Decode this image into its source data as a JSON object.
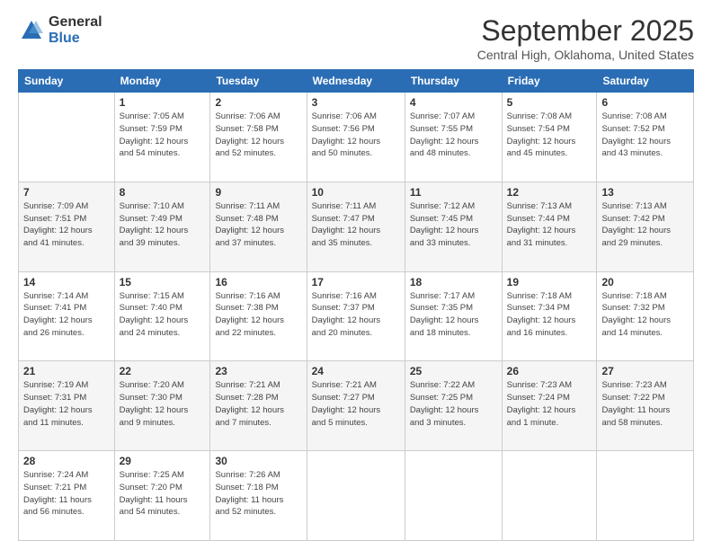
{
  "header": {
    "logo_general": "General",
    "logo_blue": "Blue",
    "month_title": "September 2025",
    "location": "Central High, Oklahoma, United States"
  },
  "days_of_week": [
    "Sunday",
    "Monday",
    "Tuesday",
    "Wednesday",
    "Thursday",
    "Friday",
    "Saturday"
  ],
  "weeks": [
    [
      {
        "day": "",
        "info": ""
      },
      {
        "day": "1",
        "info": "Sunrise: 7:05 AM\nSunset: 7:59 PM\nDaylight: 12 hours\nand 54 minutes."
      },
      {
        "day": "2",
        "info": "Sunrise: 7:06 AM\nSunset: 7:58 PM\nDaylight: 12 hours\nand 52 minutes."
      },
      {
        "day": "3",
        "info": "Sunrise: 7:06 AM\nSunset: 7:56 PM\nDaylight: 12 hours\nand 50 minutes."
      },
      {
        "day": "4",
        "info": "Sunrise: 7:07 AM\nSunset: 7:55 PM\nDaylight: 12 hours\nand 48 minutes."
      },
      {
        "day": "5",
        "info": "Sunrise: 7:08 AM\nSunset: 7:54 PM\nDaylight: 12 hours\nand 45 minutes."
      },
      {
        "day": "6",
        "info": "Sunrise: 7:08 AM\nSunset: 7:52 PM\nDaylight: 12 hours\nand 43 minutes."
      }
    ],
    [
      {
        "day": "7",
        "info": "Sunrise: 7:09 AM\nSunset: 7:51 PM\nDaylight: 12 hours\nand 41 minutes."
      },
      {
        "day": "8",
        "info": "Sunrise: 7:10 AM\nSunset: 7:49 PM\nDaylight: 12 hours\nand 39 minutes."
      },
      {
        "day": "9",
        "info": "Sunrise: 7:11 AM\nSunset: 7:48 PM\nDaylight: 12 hours\nand 37 minutes."
      },
      {
        "day": "10",
        "info": "Sunrise: 7:11 AM\nSunset: 7:47 PM\nDaylight: 12 hours\nand 35 minutes."
      },
      {
        "day": "11",
        "info": "Sunrise: 7:12 AM\nSunset: 7:45 PM\nDaylight: 12 hours\nand 33 minutes."
      },
      {
        "day": "12",
        "info": "Sunrise: 7:13 AM\nSunset: 7:44 PM\nDaylight: 12 hours\nand 31 minutes."
      },
      {
        "day": "13",
        "info": "Sunrise: 7:13 AM\nSunset: 7:42 PM\nDaylight: 12 hours\nand 29 minutes."
      }
    ],
    [
      {
        "day": "14",
        "info": "Sunrise: 7:14 AM\nSunset: 7:41 PM\nDaylight: 12 hours\nand 26 minutes."
      },
      {
        "day": "15",
        "info": "Sunrise: 7:15 AM\nSunset: 7:40 PM\nDaylight: 12 hours\nand 24 minutes."
      },
      {
        "day": "16",
        "info": "Sunrise: 7:16 AM\nSunset: 7:38 PM\nDaylight: 12 hours\nand 22 minutes."
      },
      {
        "day": "17",
        "info": "Sunrise: 7:16 AM\nSunset: 7:37 PM\nDaylight: 12 hours\nand 20 minutes."
      },
      {
        "day": "18",
        "info": "Sunrise: 7:17 AM\nSunset: 7:35 PM\nDaylight: 12 hours\nand 18 minutes."
      },
      {
        "day": "19",
        "info": "Sunrise: 7:18 AM\nSunset: 7:34 PM\nDaylight: 12 hours\nand 16 minutes."
      },
      {
        "day": "20",
        "info": "Sunrise: 7:18 AM\nSunset: 7:32 PM\nDaylight: 12 hours\nand 14 minutes."
      }
    ],
    [
      {
        "day": "21",
        "info": "Sunrise: 7:19 AM\nSunset: 7:31 PM\nDaylight: 12 hours\nand 11 minutes."
      },
      {
        "day": "22",
        "info": "Sunrise: 7:20 AM\nSunset: 7:30 PM\nDaylight: 12 hours\nand 9 minutes."
      },
      {
        "day": "23",
        "info": "Sunrise: 7:21 AM\nSunset: 7:28 PM\nDaylight: 12 hours\nand 7 minutes."
      },
      {
        "day": "24",
        "info": "Sunrise: 7:21 AM\nSunset: 7:27 PM\nDaylight: 12 hours\nand 5 minutes."
      },
      {
        "day": "25",
        "info": "Sunrise: 7:22 AM\nSunset: 7:25 PM\nDaylight: 12 hours\nand 3 minutes."
      },
      {
        "day": "26",
        "info": "Sunrise: 7:23 AM\nSunset: 7:24 PM\nDaylight: 12 hours\nand 1 minute."
      },
      {
        "day": "27",
        "info": "Sunrise: 7:23 AM\nSunset: 7:22 PM\nDaylight: 11 hours\nand 58 minutes."
      }
    ],
    [
      {
        "day": "28",
        "info": "Sunrise: 7:24 AM\nSunset: 7:21 PM\nDaylight: 11 hours\nand 56 minutes."
      },
      {
        "day": "29",
        "info": "Sunrise: 7:25 AM\nSunset: 7:20 PM\nDaylight: 11 hours\nand 54 minutes."
      },
      {
        "day": "30",
        "info": "Sunrise: 7:26 AM\nSunset: 7:18 PM\nDaylight: 11 hours\nand 52 minutes."
      },
      {
        "day": "",
        "info": ""
      },
      {
        "day": "",
        "info": ""
      },
      {
        "day": "",
        "info": ""
      },
      {
        "day": "",
        "info": ""
      }
    ]
  ],
  "row_backgrounds": [
    "#fff",
    "#f5f5f5",
    "#fff",
    "#f5f5f5",
    "#fff"
  ]
}
